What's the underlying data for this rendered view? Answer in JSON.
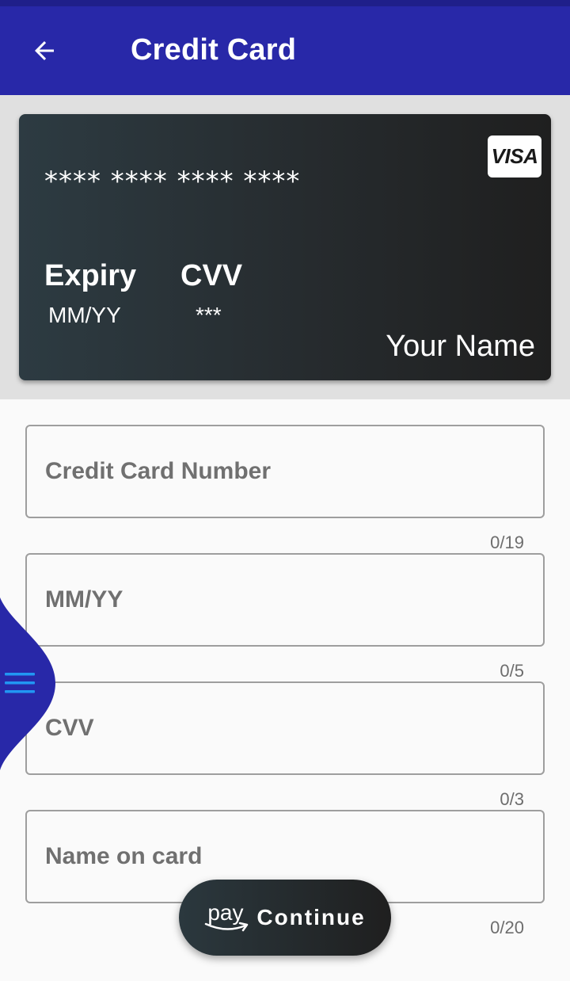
{
  "appbar": {
    "title": "Credit Card"
  },
  "card": {
    "brand": "VISA",
    "number_mask": "**** **** **** ****",
    "expiry_label": "Expiry",
    "expiry_value": "MM/YY",
    "cvv_label": "CVV",
    "cvv_value": "***",
    "holder_name": "Your Name"
  },
  "form": {
    "fields": [
      {
        "placeholder": "Credit Card Number",
        "value": "",
        "counter": "0/19"
      },
      {
        "placeholder": "MM/YY",
        "value": "",
        "counter": "0/5"
      },
      {
        "placeholder": "CVV",
        "value": "",
        "counter": "0/3"
      },
      {
        "placeholder": "Name on card",
        "value": "",
        "counter": "0/20"
      }
    ]
  },
  "continue_button": {
    "pay_logo_text": "pay",
    "label": "Continue"
  },
  "colors": {
    "appbar": "#2828a8",
    "drawer_tab": "#2828a8",
    "menu_icon": "#2196f3",
    "card_dark": "#262b2e"
  },
  "icons": {
    "back": "arrow-left-icon",
    "menu": "hamburger-menu-icon",
    "pay_logo": "amazon-pay-logo"
  }
}
